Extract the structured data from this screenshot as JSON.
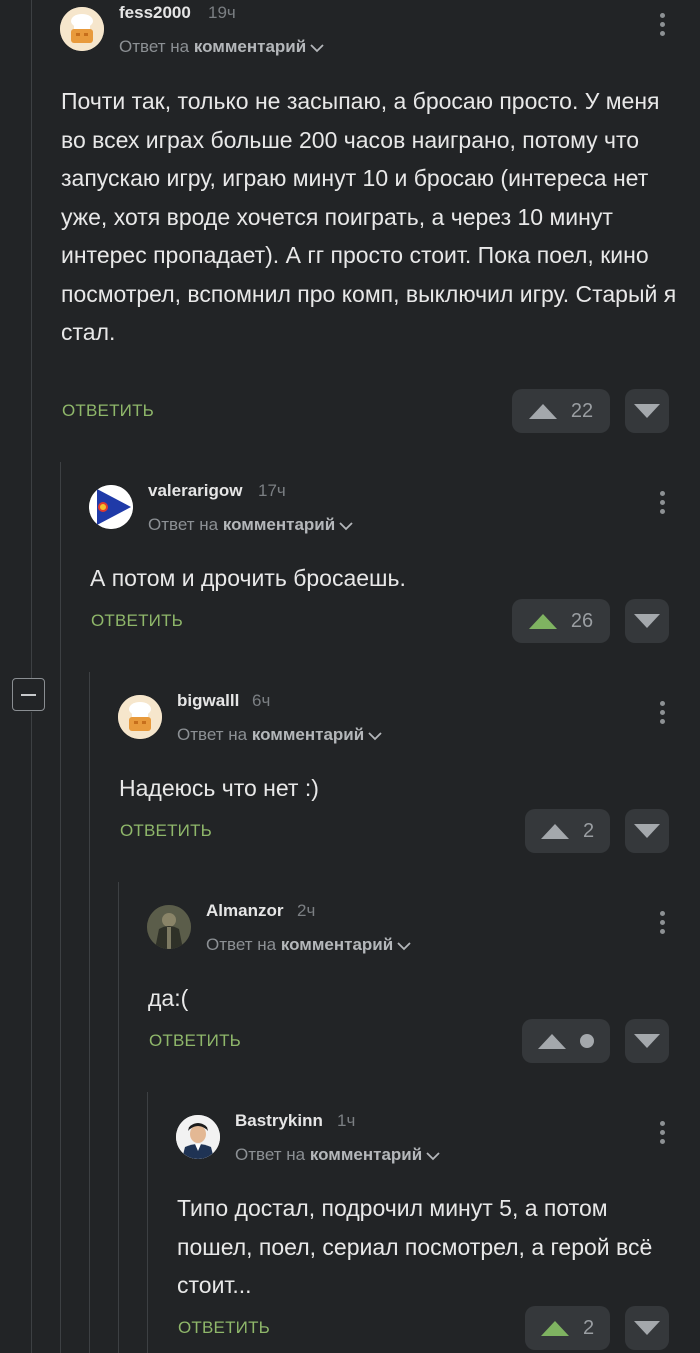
{
  "reply_to_prefix": "Ответ на",
  "reply_to_target": "комментарий",
  "reply_label": "ОТВЕТИТЬ",
  "colors": {
    "background": "#222426",
    "accent_green": "#8fb76a",
    "button_bg": "#35383b"
  },
  "comments": [
    {
      "author": "fess2000",
      "time": "19ч",
      "avatar": "default-chef-avatar",
      "text": "Почти так, только не засыпаю, а бросаю просто. У меня во всех играх больше 200 часов наиграно, потому что запускаю игру, играю минут 10 и бросаю (интереса нет уже, хотя вроде хочется поиграть, а через 10 минут интерес пропадает). А гг просто стоит. Пока поел, кино посмотрел, вспомнил про комп, выключил игру. Старый я стал.",
      "rating": "22",
      "upvoted": false
    },
    {
      "author": "valerarigow",
      "time": "17ч",
      "avatar": "flag-avatar",
      "text": "А потом и дрочить бросаешь.",
      "rating": "26",
      "upvoted": true
    },
    {
      "author": "bigwalll",
      "time": "6ч",
      "avatar": "default-chef-avatar",
      "text": "Надеюсь что нет :)",
      "rating": "2",
      "upvoted": false
    },
    {
      "author": "Almanzor",
      "time": "2ч",
      "avatar": "photo-avatar",
      "text": "да:(",
      "rating": "",
      "upvoted": false
    },
    {
      "author": "Bastrykinn",
      "time": "1ч",
      "avatar": "photo-avatar",
      "text": "Типо достал, подрочил минут 5, а потом пошел, поел, сериал посмотрел, а герой всё стоит...",
      "rating": "2",
      "upvoted": true
    }
  ]
}
